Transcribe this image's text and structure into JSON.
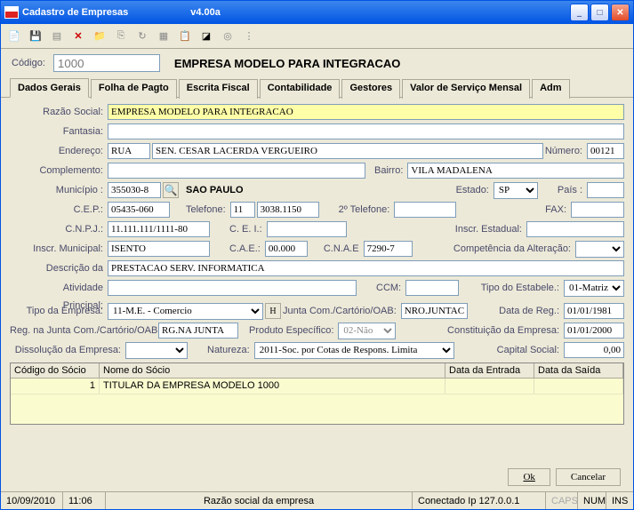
{
  "window": {
    "title": "Cadastro de Empresas",
    "version": "v4.00a"
  },
  "header": {
    "codigo_label": "Código:",
    "codigo": "1000",
    "nome": "EMPRESA MODELO PARA INTEGRACAO"
  },
  "tabs": [
    "Dados Gerais",
    "Folha de Pagto",
    "Escrita Fiscal",
    "Contabilidade",
    "Gestores",
    "Valor de Serviço Mensal",
    "Adm"
  ],
  "labels": {
    "razao": "Razão Social:",
    "fantasia": "Fantasia:",
    "endereco": "Endereço:",
    "numero": "Número:",
    "complemento": "Complemento:",
    "bairro": "Bairro:",
    "municipio": "Município :",
    "estado": "Estado:",
    "pais": "País :",
    "cep": "C.E.P.:",
    "telefone": "Telefone:",
    "telefone2": "2º Telefone:",
    "fax": "FAX:",
    "cnpj": "C.N.P.J.:",
    "cei": "C. E. I.:",
    "inscr_est": "Inscr. Estadual:",
    "inscr_mun": "Inscr. Municipal:",
    "cae": "C.A.E.:",
    "cnae": "C.N.A.E",
    "comp_alt": "Competência da Alteração:",
    "desc_ativ": "Descrição da Atividade Principal:",
    "desc_ativ1": "Descrição da",
    "desc_ativ2": "Atividade",
    "desc_ativ3": "Principal:",
    "ccm": "CCM:",
    "tipo_estab": "Tipo do Estabele.:",
    "tipo_emp": "Tipo da Empresa:",
    "h": "H",
    "junta": "Junta Com./Cartório/OAB:",
    "data_reg": "Data de Reg.:",
    "reg_junta": "Reg. na Junta Com./Cartório/OAB:",
    "prod_esp": "Produto Específico:",
    "const_emp": "Constituição da Empresa:",
    "dissol": "Dissolução da Empresa:",
    "natureza": "Natureza:",
    "cap_social": "Capital Social:"
  },
  "values": {
    "razao": "EMPRESA MODELO PARA INTEGRACAO",
    "fantasia": "",
    "logradouro": "RUA",
    "endereco": "SEN. CESAR LACERDA VERGUEIRO",
    "numero": "00121",
    "complemento": "",
    "bairro": "VILA MADALENA",
    "municipio_cod": "355030-8",
    "municipio_nome": "SAO PAULO",
    "estado": "SP",
    "pais": "",
    "cep": "05435-060",
    "ddd": "11",
    "telefone": "3038.1150",
    "telefone2": "",
    "fax": "",
    "cnpj": "11.111.111/1111-80",
    "cei": "",
    "inscr_est": "",
    "inscr_mun": "ISENTO",
    "cae": "00.000",
    "cnae": "7290-7",
    "comp_alt": "",
    "atividade": "PRESTACAO SERV. INFORMATICA",
    "ativ2": "",
    "ccm": "",
    "tipo_estab": "01-Matriz",
    "tipo_emp": "11-M.E. - Comercio",
    "junta": "NRO.JUNTAC",
    "data_reg": "01/01/1981",
    "reg_junta": "RG.NA JUNTA",
    "prod_esp": "02-Não",
    "const_emp": "01/01/2000",
    "dissol": "",
    "natureza": "2011-Soc. por Cotas de Respons. Limita",
    "cap_social": "0,00"
  },
  "grid": {
    "headers": [
      "Código do Sócio",
      "Nome do Sócio",
      "Data da Entrada",
      "Data da Saída"
    ],
    "row": {
      "codigo": "1",
      "nome": "TITULAR DA EMPRESA MODELO 1000",
      "entrada": "",
      "saida": ""
    }
  },
  "buttons": {
    "ok": "Ok",
    "cancelar": "Cancelar"
  },
  "status": {
    "date": "10/09/2010",
    "time": "11:06",
    "hint": "Razão social da empresa",
    "conn": "Conectado Ip 127.0.0.1",
    "caps": "CAPS",
    "num": "NUM",
    "ins": "INS"
  }
}
